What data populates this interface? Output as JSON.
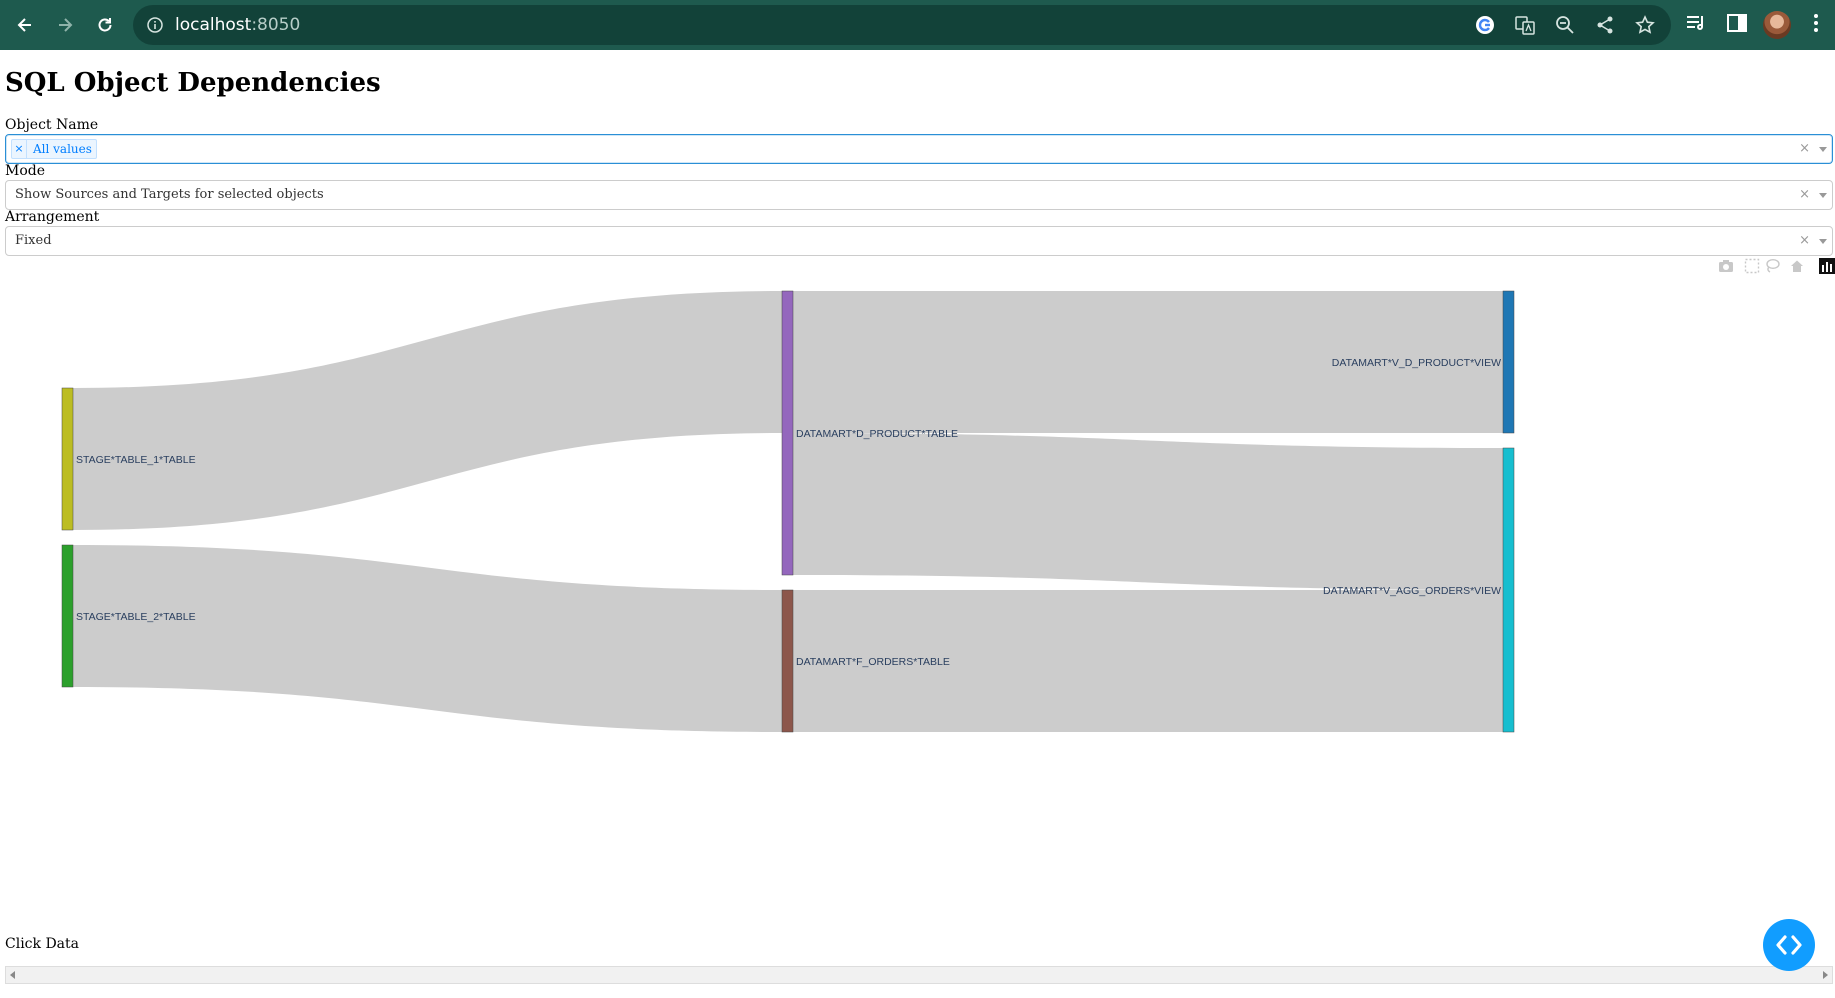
{
  "browser": {
    "url_host": "localhost",
    "url_port": ":8050",
    "accent_color": "#1e5a4e"
  },
  "page": {
    "title": "SQL Object Dependencies",
    "object_name": {
      "label": "Object Name",
      "chip": "All values",
      "chip_remove": "×",
      "clear": "×"
    },
    "mode": {
      "label": "Mode",
      "value": "Show Sources and Targets for selected objects",
      "clear": "×"
    },
    "arrangement": {
      "label": "Arrangement",
      "value": "Fixed",
      "clear": "×"
    },
    "click_data_label": "Click Data"
  },
  "modebar": [
    "camera-icon",
    "box-select-icon",
    "lasso-icon",
    "home-icon",
    "plotly-logo-icon"
  ],
  "chart_data": {
    "type": "sankey",
    "arrangement": "fixed",
    "nodes": [
      {
        "label": "STAGE*TABLE_1*TABLE",
        "color": "#bcbd22"
      },
      {
        "label": "STAGE*TABLE_2*TABLE",
        "color": "#2ca02c"
      },
      {
        "label": "DATAMART*D_PRODUCT*TABLE",
        "color": "#9467bd"
      },
      {
        "label": "DATAMART*F_ORDERS*TABLE",
        "color": "#8c564b"
      },
      {
        "label": "DATAMART*V_D_PRODUCT*VIEW",
        "color": "#1f77b4"
      },
      {
        "label": "DATAMART*V_AGG_ORDERS*VIEW",
        "color": "#17becf"
      }
    ],
    "links": [
      {
        "source": "STAGE*TABLE_1*TABLE",
        "target": "DATAMART*D_PRODUCT*TABLE",
        "value": 1
      },
      {
        "source": "STAGE*TABLE_2*TABLE",
        "target": "DATAMART*F_ORDERS*TABLE",
        "value": 1
      },
      {
        "source": "DATAMART*D_PRODUCT*TABLE",
        "target": "DATAMART*V_D_PRODUCT*VIEW",
        "value": 1
      },
      {
        "source": "DATAMART*D_PRODUCT*TABLE",
        "target": "DATAMART*V_AGG_ORDERS*VIEW",
        "value": 1
      },
      {
        "source": "DATAMART*F_ORDERS*TABLE",
        "target": "DATAMART*V_AGG_ORDERS*VIEW",
        "value": 1
      }
    ],
    "link_color": "#cccccc"
  }
}
